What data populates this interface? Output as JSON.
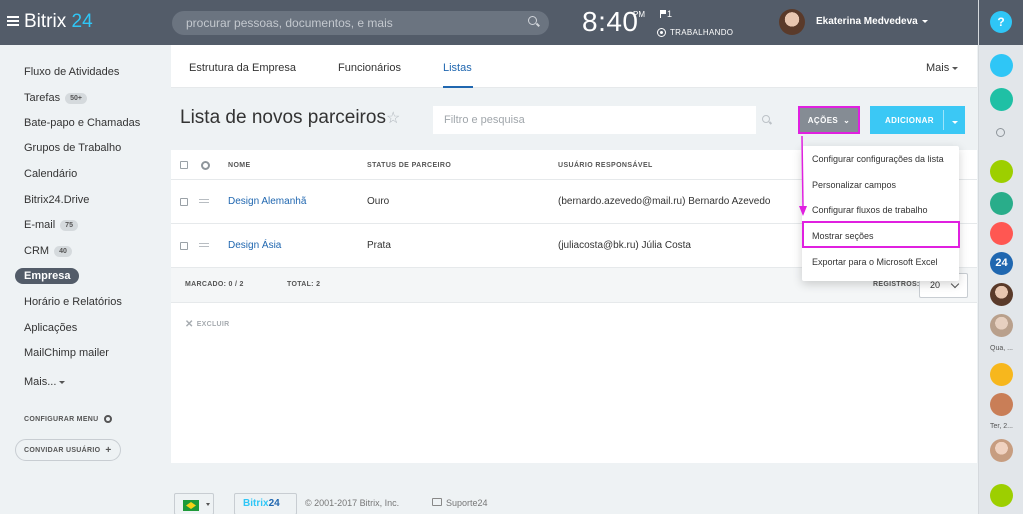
{
  "header": {
    "logo_text": "Bitrix",
    "logo_num": "24",
    "search_placeholder": "procurar pessoas, documentos, e mais",
    "time": "8:40",
    "ampm": "PM",
    "flag_count": "1",
    "work_status": "TRABALHANDO",
    "user_name": "Ekaterina Medvedeva"
  },
  "sidebar": {
    "items": [
      {
        "label": "Fluxo de Atividades"
      },
      {
        "label": "Tarefas",
        "badge": "50+"
      },
      {
        "label": "Bate-papo e Chamadas"
      },
      {
        "label": "Grupos de Trabalho"
      },
      {
        "label": "Calendário"
      },
      {
        "label": "Bitrix24.Drive"
      },
      {
        "label": "E-mail",
        "badge": "75"
      },
      {
        "label": "CRM",
        "badge": "40"
      },
      {
        "label": "Empresa"
      },
      {
        "label": "Horário e Relatórios"
      },
      {
        "label": "Aplicações"
      },
      {
        "label": "MailChimp mailer"
      },
      {
        "label": "Mais..."
      }
    ],
    "config_menu": "CONFIGURAR MENU",
    "invite_user": "CONVIDAR USUÁRIO"
  },
  "tabs": [
    "Estrutura da Empresa",
    "Funcionários",
    "Listas"
  ],
  "tabs_more": "Mais",
  "page": {
    "title": "Lista de novos parceiros",
    "filter_placeholder": "Filtro e pesquisa",
    "actions_label": "AÇÕES",
    "add_label": "ADICIONAR"
  },
  "table": {
    "columns": [
      "NOME",
      "STATUS DE PARCEIRO",
      "USUÁRIO RESPONSÁVEL"
    ],
    "rows": [
      {
        "name": "Design Alemanhã",
        "status": "Ouro",
        "user": "(bernardo.azevedo@mail.ru) Bernardo Azevedo"
      },
      {
        "name": "Design Ásia",
        "status": "Prata",
        "user": "(juliacosta@bk.ru) Júlia Costa"
      }
    ],
    "marked_label": "MARCADO:",
    "marked_value": "0 / 2",
    "total_label": "TOTAL:",
    "total_value": "2",
    "records_label": "REGISTROS:",
    "page_size": "20",
    "delete_label": "EXCLUIR"
  },
  "dropdown": {
    "items": [
      "Configurar configurações da lista",
      "Personalizar campos",
      "Configurar fluxos de trabalho",
      "Mostrar seções",
      "Exportar para o Microsoft Excel"
    ]
  },
  "rail": {
    "help": "?",
    "b24": "24",
    "label_1": "Qua, ...",
    "label_2": "Ter, 2..."
  },
  "footer": {
    "b24_b": "Bitrix",
    "b24_n": "24",
    "copyright": "© 2001-2017 Bitrix, Inc.",
    "support": "Suporte24"
  },
  "colors": {
    "topbar": "#535c69",
    "accent": "#2fc6f6",
    "link": "#2067b0",
    "highlight": "#e020e0"
  }
}
